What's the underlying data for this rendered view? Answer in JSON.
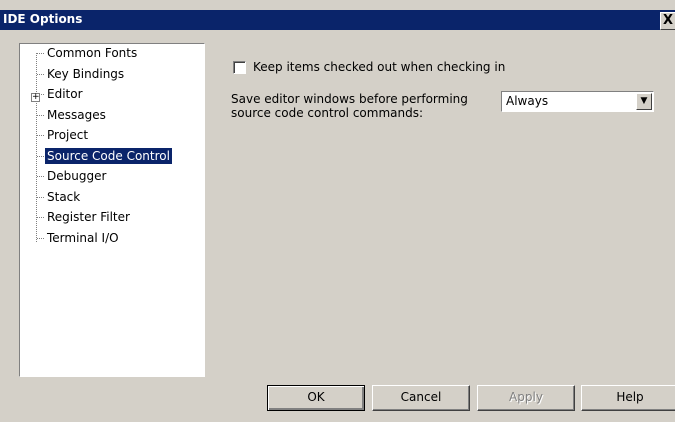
{
  "window": {
    "title": "IDE Options",
    "close_label": "X"
  },
  "tree": {
    "items": [
      {
        "label": "Common Fonts"
      },
      {
        "label": "Key Bindings"
      },
      {
        "label": "Editor",
        "expander": "+"
      },
      {
        "label": "Messages"
      },
      {
        "label": "Project"
      },
      {
        "label": "Source Code Control",
        "selected": true
      },
      {
        "label": "Debugger"
      },
      {
        "label": "Stack"
      },
      {
        "label": "Register Filter"
      },
      {
        "label": "Terminal I/O"
      }
    ]
  },
  "options": {
    "keep_checked_out": {
      "label": "Keep items checked out when checking in",
      "checked": false
    },
    "save_editor": {
      "label_line1": "Save editor windows before performing",
      "label_line2": "source code control commands:",
      "value": "Always"
    }
  },
  "buttons": {
    "ok": "OK",
    "cancel": "Cancel",
    "apply": "Apply",
    "help": "Help"
  }
}
